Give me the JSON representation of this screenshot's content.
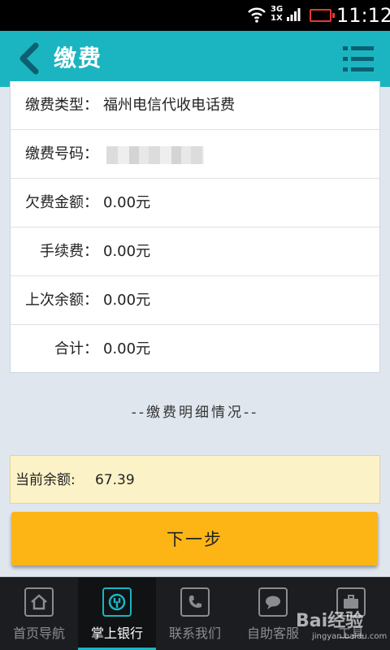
{
  "status_bar": {
    "network": "3G",
    "network2": "1X",
    "time": "11:12"
  },
  "header": {
    "title": "缴费",
    "back_icon": "back-arrow-icon",
    "menu_icon": "menu-list-icon",
    "color": "#1ab5c0"
  },
  "details": [
    {
      "label": "缴费类型：",
      "value": "福州电信代收电话费"
    },
    {
      "label": "缴费号码：",
      "value": ""
    },
    {
      "label": "欠费金额：",
      "value": "0.00元"
    },
    {
      "label": "手续费：",
      "value": "0.00元"
    },
    {
      "label": "上次余额：",
      "value": "0.00元"
    },
    {
      "label": "合计：",
      "value": "0.00元"
    }
  ],
  "detail_link": "--缴费明细情况--",
  "balance": {
    "label": "当前余额:",
    "value": "67.39"
  },
  "next_button": {
    "label": "下一步",
    "color": "#fdb515"
  },
  "tabs": [
    {
      "label": "首页导航",
      "icon": "home-icon",
      "active": false
    },
    {
      "label": "掌上银行",
      "icon": "bank-icon",
      "active": true
    },
    {
      "label": "联系我们",
      "icon": "phone-icon",
      "active": false
    },
    {
      "label": "自助客服",
      "icon": "chat-icon",
      "active": false
    },
    {
      "label": "工具",
      "icon": "briefcase-icon",
      "active": false
    }
  ],
  "watermark": {
    "text": "Bai经验",
    "sub": "jingyan.baidu.com"
  }
}
